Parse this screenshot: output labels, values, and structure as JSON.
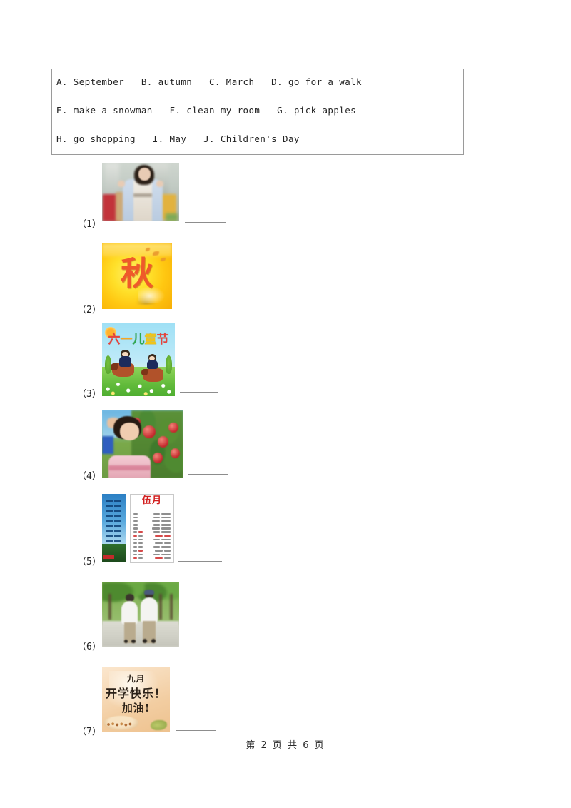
{
  "page": {
    "background_color": "#ffffff",
    "footer_text": "第 2 页 共 6 页"
  },
  "option_box": {
    "border_color": "#9a9a9a",
    "lines": [
      "A. September   B. autumn   C. March   D. go for a walk",
      "E. make a snowman   F. clean my room   G. pick apples",
      "H. go shopping   I. May   J. Children's Day"
    ],
    "options": [
      {
        "letter": "A",
        "text": "September"
      },
      {
        "letter": "B",
        "text": "autumn"
      },
      {
        "letter": "C",
        "text": "March"
      },
      {
        "letter": "D",
        "text": "go for a walk"
      },
      {
        "letter": "E",
        "text": "make a snowman"
      },
      {
        "letter": "F",
        "text": "clean my room"
      },
      {
        "letter": "G",
        "text": "pick apples"
      },
      {
        "letter": "H",
        "text": "go shopping"
      },
      {
        "letter": "I",
        "text": "May"
      },
      {
        "letter": "J",
        "text": "Children's Day"
      }
    ]
  },
  "questions": [
    {
      "label": "（1）",
      "picture_description": "woman holding shopping bags",
      "answer_value": ""
    },
    {
      "label": "（2）",
      "picture_description": "yellow autumn poster with Chinese character",
      "picture_text": "秋",
      "answer_value": ""
    },
    {
      "label": "（3）",
      "picture_description": "children's day poster with kids riding horses",
      "picture_text": "六一儿童节",
      "answer_value": ""
    },
    {
      "label": "（4）",
      "picture_description": "girl picking apples from a tree",
      "answer_value": ""
    },
    {
      "label": "（5）",
      "picture_description": "calendar page for May",
      "picture_text": "伍月",
      "answer_value": ""
    },
    {
      "label": "（6）",
      "picture_description": "elderly couple walking on a tree-lined path",
      "answer_value": ""
    },
    {
      "label": "（7）",
      "picture_description": "handwritten September back-to-school greeting",
      "picture_text_lines": [
        "九月",
        "开学快乐！",
        "加油!"
      ],
      "answer_value": ""
    }
  ]
}
